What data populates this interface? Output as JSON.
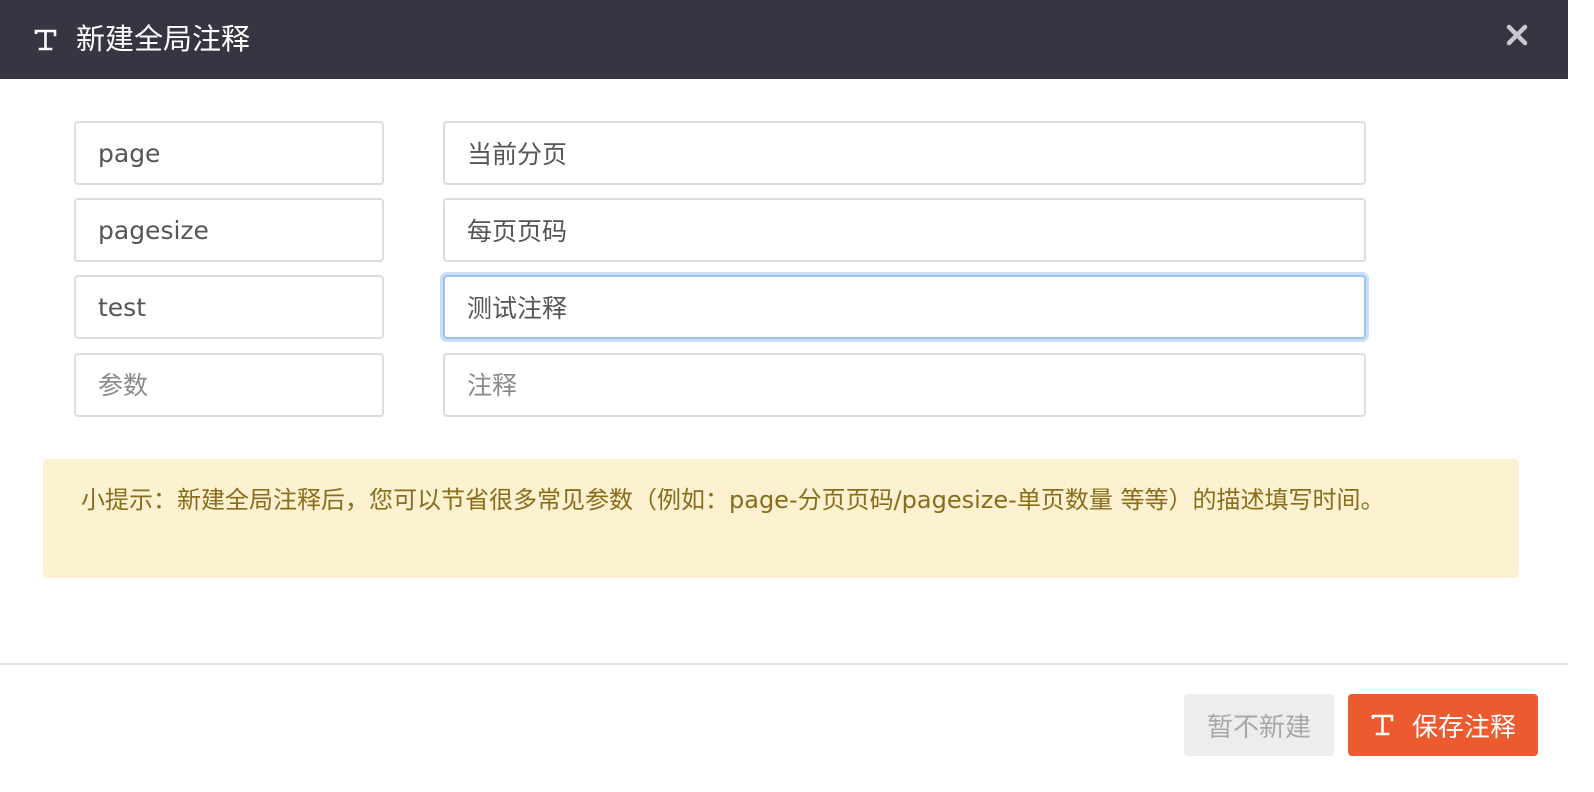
{
  "header": {
    "title": "新建全局注释",
    "icon": "text-format-icon",
    "close_icon": "close-icon",
    "background": "#363642"
  },
  "rows": [
    {
      "param": "page",
      "param_placeholder": "参数",
      "comment": "当前分页",
      "comment_placeholder": "注释"
    },
    {
      "param": "pagesize",
      "param_placeholder": "参数",
      "comment": "每页页码",
      "comment_placeholder": "注释"
    },
    {
      "param": "test",
      "param_placeholder": "参数",
      "comment": "测试注释",
      "comment_placeholder": "注释"
    },
    {
      "param": "",
      "param_placeholder": "参数",
      "comment": "",
      "comment_placeholder": "注释"
    }
  ],
  "tip": {
    "text": "小提示：新建全局注释后，您可以节省很多常见参数（例如：page-分页页码/pagesize-单页数量 等等）的描述填写时间。",
    "background": "#fcf1d0",
    "color": "#8a6d1a"
  },
  "footer": {
    "skip_label": "暂不新建",
    "save_label": "保存注释",
    "save_icon": "text-format-icon",
    "accent": "#ee5a2f"
  }
}
